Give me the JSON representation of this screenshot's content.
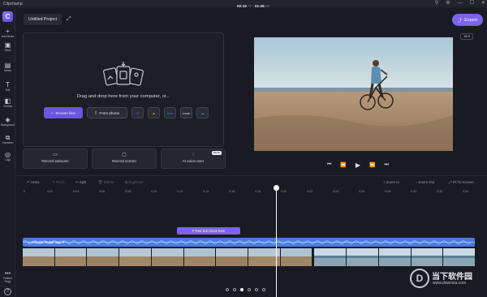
{
  "window": {
    "title": "Clipchamp",
    "controls": [
      "⚲",
      "⚙",
      "—",
      "☐",
      "✕"
    ]
  },
  "sidebar": {
    "logo": "C",
    "items": [
      {
        "label": "Add Media",
        "icon": "plus-icon",
        "glyph": "+"
      },
      {
        "label": "Stock",
        "icon": "stock-icon",
        "glyph": "▣"
      },
      {
        "label": "Media",
        "icon": "media-icon",
        "glyph": "▤"
      },
      {
        "label": "Text",
        "icon": "text-icon",
        "glyph": "T"
      },
      {
        "label": "Overlay",
        "icon": "overlay-icon",
        "glyph": "◧"
      },
      {
        "label": "Background",
        "icon": "background-icon",
        "glyph": "◈"
      },
      {
        "label": "Transition",
        "icon": "transition-icon",
        "glyph": "⧉"
      },
      {
        "label": "Logo",
        "icon": "logo-icon",
        "glyph": "◎"
      }
    ],
    "feature_flags": "Feature Flags",
    "help": "?"
  },
  "header": {
    "project_name": "Untitled Project",
    "export_label": "Export",
    "aspect_ratio": "16:9"
  },
  "upload": {
    "drop_text": "Drag and drop here from your computer, or...",
    "browse_label": "Browse files",
    "phone_label": "From phone",
    "cloud_sources": [
      "G",
      "▲",
      "box",
      "zoom",
      "☁"
    ]
  },
  "record": {
    "webcam": "Record webcam",
    "screen": "Record screen",
    "voice": "AI voice over",
    "beta": "BETA"
  },
  "playback": {
    "controls": [
      "⏮",
      "⏪",
      "▶",
      "⏩",
      "⏭"
    ]
  },
  "timeline": {
    "undo": "Undo",
    "redo": "Redo",
    "split": "Split",
    "delete": "Delete",
    "duplicate": "Duplicate",
    "current_time": "00:19",
    "current_frames": ".77",
    "total_time": "01:28",
    "total_frames": ".86",
    "zoom_in": "Zoom In",
    "zoom_out": "Zoom Out",
    "fit": "Fit To Screen",
    "ruler": [
      "0",
      "0:02",
      "0:04",
      "0:06",
      "0:08",
      "0:10",
      "0:12",
      "0:14",
      "0:16",
      "0:18",
      "0:20",
      "0:22",
      "0:24",
      "0:26",
      "0:28",
      "0:30",
      "0:32",
      "0:34"
    ],
    "text_clip": "Your text Goes here",
    "audio_clip": "Acoustic Guitar Jam 3"
  },
  "watermark": {
    "brand": "当下软件园",
    "url": "www.downxia.com",
    "mark": "D"
  },
  "colors": {
    "accent": "#7b63f0",
    "audio": "#4a7ce0",
    "bg": "#1a1a24"
  }
}
